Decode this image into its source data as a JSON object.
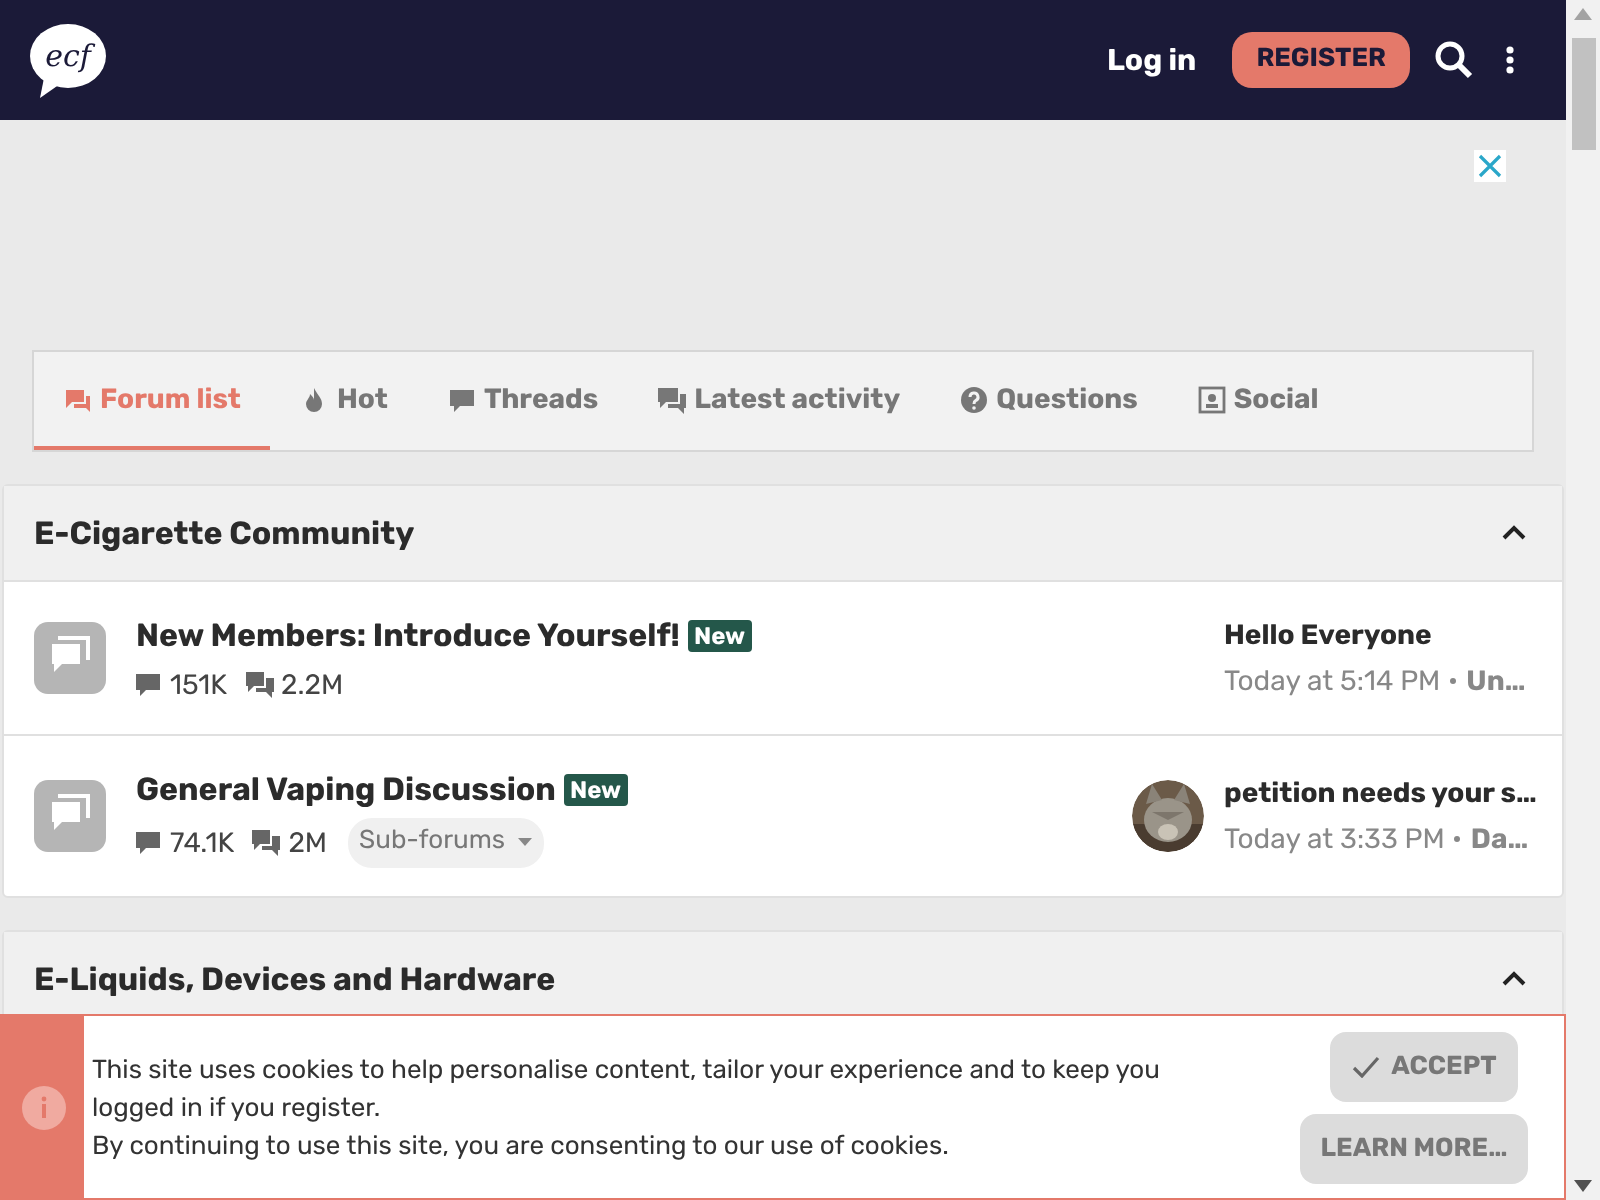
{
  "header": {
    "logo": "ecf",
    "login": "Log in",
    "register": "REGISTER"
  },
  "tabs": [
    {
      "label": "Forum list",
      "kind": "chat",
      "selected": true
    },
    {
      "label": "Hot",
      "kind": "flame",
      "selected": false
    },
    {
      "label": "Threads",
      "kind": "comment",
      "selected": false
    },
    {
      "label": "Latest activity",
      "kind": "comments",
      "selected": false
    },
    {
      "label": "Questions",
      "kind": "question",
      "selected": false
    },
    {
      "label": "Social",
      "kind": "contact",
      "selected": false
    }
  ],
  "categories": [
    {
      "title": "E-Cigarette Community",
      "expanded": true,
      "forums": [
        {
          "title": "New Members: Introduce Yourself!",
          "badge": "New",
          "threads": "151K",
          "messages": "2.2M",
          "last_title": "Hello Everyone",
          "last_time": "Today at 5:14 PM",
          "last_user": "Un…"
        },
        {
          "title": "General Vaping Discussion",
          "badge": "New",
          "threads": "74.1K",
          "messages": "2M",
          "subforums": "Sub-forums",
          "last_title": "petition needs your s…",
          "last_time": "Today at 3:33 PM",
          "last_user": "Da…"
        }
      ]
    },
    {
      "title": "E-Liquids, Devices and Hardware",
      "expanded": true
    }
  ],
  "cookie_notice": {
    "lines": [
      "This site uses cookies to help personalise content, tailor your experience and to keep you logged in if you register.",
      "By continuing to use this site, you are consenting to our use of cookies."
    ],
    "accept": "ACCEPT",
    "learn_more": "LEARN MORE…"
  }
}
